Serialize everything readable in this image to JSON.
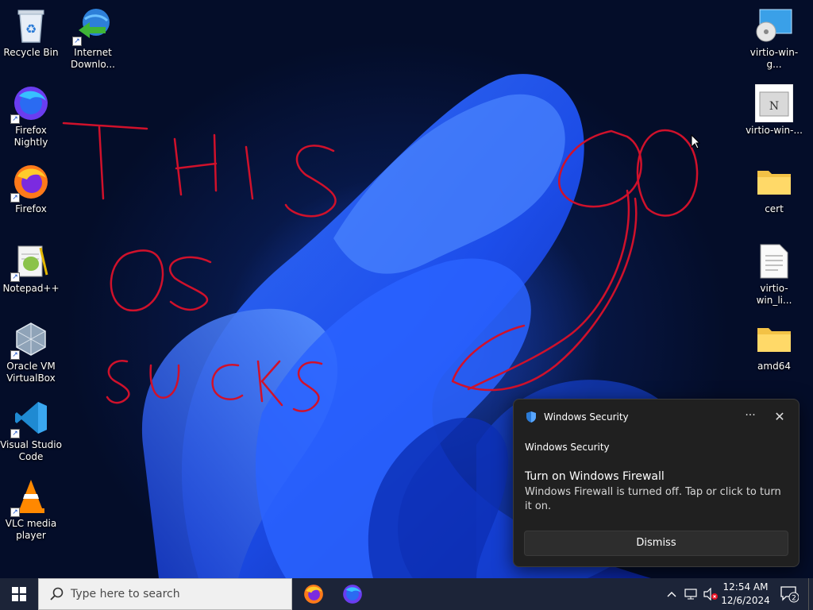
{
  "desktop": {
    "icons_left": [
      {
        "label": "Recycle Bin",
        "icon": "recycle-bin-icon"
      },
      {
        "label": "Internet Downlo...",
        "icon": "internet-download-manager-icon"
      },
      {
        "label": "Firefox Nightly",
        "icon": "firefox-nightly-icon"
      },
      {
        "label": "Firefox",
        "icon": "firefox-icon"
      },
      {
        "label": "Notepad++",
        "icon": "notepad-plus-plus-icon"
      },
      {
        "label": "Oracle VM VirtualBox",
        "icon": "virtualbox-icon"
      },
      {
        "label": "Visual Studio Code",
        "icon": "vscode-icon"
      },
      {
        "label": "VLC media player",
        "icon": "vlc-icon"
      }
    ],
    "icons_right": [
      {
        "label": "virtio-win-g...",
        "icon": "disc-drive-icon"
      },
      {
        "label": "virtio-win-...",
        "icon": "installer-icon"
      },
      {
        "label": "cert",
        "icon": "folder-icon"
      },
      {
        "label": "virtio-win_li...",
        "icon": "text-file-icon"
      },
      {
        "label": "amd64",
        "icon": "folder-icon"
      }
    ],
    "scribble_text": "THIS OS SUCKS"
  },
  "toast": {
    "header_label": "Windows Security",
    "more_label": "···",
    "close_label": "✕",
    "app_name": "Windows Security",
    "title": "Turn on Windows Firewall",
    "body": "Windows Firewall is turned off. Tap or click to turn it on.",
    "dismiss_label": "Dismiss"
  },
  "taskbar": {
    "search_placeholder": "Type here to search",
    "pinned": [
      "firefox-icon",
      "firefox-nightly-icon"
    ],
    "tray_chevron": "^",
    "time": "12:54 AM",
    "date": "12/6/2024",
    "notification_count": "2"
  },
  "colors": {
    "taskbar_bg": "#1c2438",
    "toast_bg": "#202020",
    "scribble": "#d0112b",
    "wallpaper_blue": "#1f55ff"
  }
}
